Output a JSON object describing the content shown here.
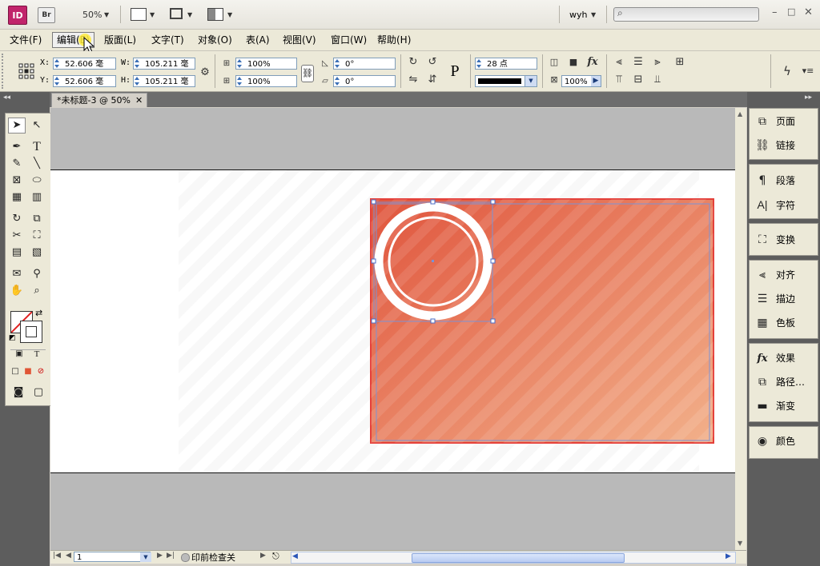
{
  "app": {
    "logo_id": "ID",
    "logo_br": "Br",
    "zoom": "50%",
    "user": "wyh",
    "search_placeholder": "",
    "window_controls": [
      "–",
      "□",
      "✕"
    ]
  },
  "menu": [
    {
      "label": "文件(F)"
    },
    {
      "label": "编辑(E)"
    },
    {
      "label": "版面(L)"
    },
    {
      "label": "文字(T)"
    },
    {
      "label": "对象(O)"
    },
    {
      "label": "表(A)"
    },
    {
      "label": "视图(V)"
    },
    {
      "label": "窗口(W)"
    },
    {
      "label": "帮助(H)"
    }
  ],
  "control": {
    "x_label": "X:",
    "x_value": "52.606 毫",
    "y_label": "Y:",
    "y_value": "52.606 毫",
    "w_label": "W:",
    "w_value": "105.211 毫",
    "h_label": "H:",
    "h_value": "105.211 毫",
    "scale_x": "100%",
    "scale_y": "100%",
    "rotate": "0°",
    "shear": "0°",
    "stroke_weight": "28 点",
    "opacity": "100%",
    "p_icon": "P"
  },
  "document": {
    "tab_title": "*未标题-3 @ 50%",
    "page_number": "1",
    "preflight": "印前检查关"
  },
  "panels": [
    {
      "label": "页面",
      "icon": "pages-icon"
    },
    {
      "label": "链接",
      "icon": "links-icon"
    },
    {
      "label": "段落",
      "icon": "paragraph-icon"
    },
    {
      "label": "字符",
      "icon": "character-icon"
    },
    {
      "label": "变换",
      "icon": "transform-icon"
    },
    {
      "label": "对齐",
      "icon": "align-icon"
    },
    {
      "label": "描边",
      "icon": "stroke-icon"
    },
    {
      "label": "色板",
      "icon": "swatches-icon"
    },
    {
      "label": "效果",
      "icon": "effects-icon"
    },
    {
      "label": "路径…",
      "icon": "pathfinder-icon"
    },
    {
      "label": "渐变",
      "icon": "gradient-icon"
    },
    {
      "label": "颜色",
      "icon": "color-icon"
    }
  ],
  "colors": {
    "rect_start": "#e0553d",
    "rect_end": "#f2b08a",
    "frame": "#e4403a",
    "selection": "#7a93d6"
  }
}
